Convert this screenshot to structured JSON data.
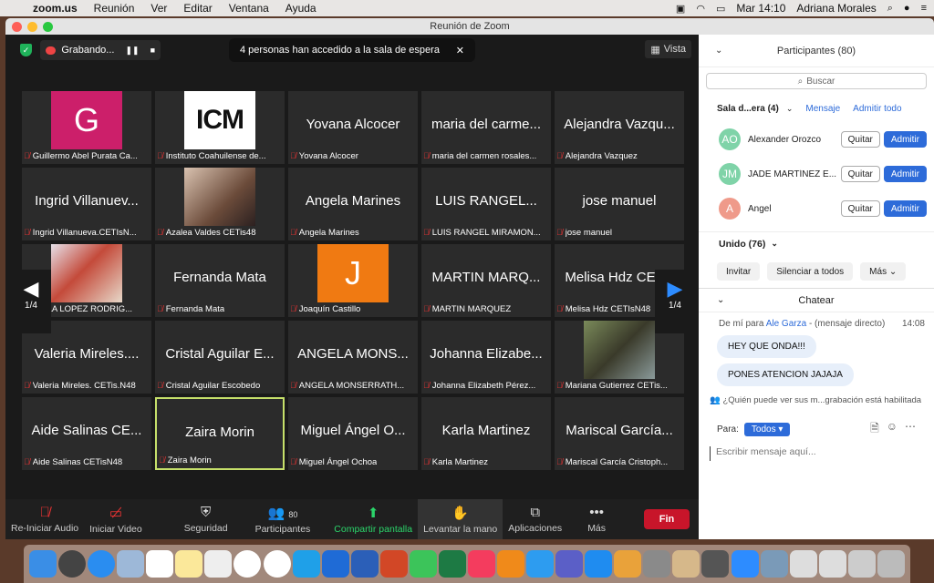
{
  "menubar": {
    "app": "zoom.us",
    "menus": [
      "Reunión",
      "Ver",
      "Editar",
      "Ventana",
      "Ayuda"
    ],
    "clock": "Mar 14:10",
    "user": "Adriana Morales"
  },
  "window": {
    "title": "Reunión de Zoom"
  },
  "topbar": {
    "recording": "Grabando...",
    "notification": "4 personas han accedido a la sala de espera",
    "view": "Vista"
  },
  "tiles": [
    {
      "big": "",
      "label": "Guillermo Abel Purata Ca...",
      "avatar": "G",
      "avatar_color": "#cc1f6a"
    },
    {
      "big": "",
      "label": "Instituto Coahuilense de...",
      "avatar": "ICM",
      "kind": "icm"
    },
    {
      "big": "Yovana Alcocer",
      "label": "Yovana Alcocer"
    },
    {
      "big": "maria del carme...",
      "label": "maria del carmen rosales..."
    },
    {
      "big": "Alejandra Vazqu...",
      "label": "Alejandra Vazquez"
    },
    {
      "big": "Ingrid Villanuev...",
      "label": "Ingrid Villanueva.CETIsN..."
    },
    {
      "big": "",
      "label": "Azalea Valdes CETis48",
      "kind": "photo1"
    },
    {
      "big": "Angela Marines",
      "label": "Angela Marines"
    },
    {
      "big": "LUIS RANGEL...",
      "label": "LUIS RANGEL MIRAMON..."
    },
    {
      "big": "jose manuel",
      "label": "jose manuel"
    },
    {
      "big": "",
      "label": "NIELA LOPEZ RODRIG...",
      "kind": "photo2"
    },
    {
      "big": "Fernanda Mata",
      "label": "Fernanda Mata"
    },
    {
      "big": "",
      "label": "Joaquín Castillo",
      "avatar": "J",
      "avatar_color": "#f07a12"
    },
    {
      "big": "MARTIN MARQ...",
      "label": "MARTIN MARQUEZ"
    },
    {
      "big": "Melisa Hdz CET...",
      "label": "Melisa Hdz CETIsN48"
    },
    {
      "big": "Valeria Mireles....",
      "label": "Valeria Mireles. CETis.N48"
    },
    {
      "big": "Cristal Aguilar E...",
      "label": "Cristal Aguilar Escobedo"
    },
    {
      "big": "ANGELA MONS...",
      "label": "ANGELA MONSERRATH..."
    },
    {
      "big": "Johanna Elizabe...",
      "label": "Johanna Elizabeth Pérez..."
    },
    {
      "big": "",
      "label": "Mariana Gutierrez CETis...",
      "kind": "photo3"
    },
    {
      "big": "Aide Salinas CE...",
      "label": "Aide Salinas CETisN48"
    },
    {
      "big": "Zaira Morin",
      "label": "Zaira Morin",
      "active": true
    },
    {
      "big": "Miguel Ángel O...",
      "label": "Miguel Ángel Ochoa"
    },
    {
      "big": "Karla Martinez",
      "label": "Karla Martinez"
    },
    {
      "big": "Mariscal García...",
      "label": "Mariscal García Cristoph..."
    }
  ],
  "pager": {
    "left": "1/4",
    "right": "1/4"
  },
  "toolbar": {
    "audio": "Re-Iniciar Audio",
    "video": "Iniciar Video",
    "security": "Seguridad",
    "participants": "Participantes",
    "participants_count": "80",
    "share": "Compartir pantalla",
    "raise": "Levantar la mano",
    "apps": "Aplicaciones",
    "more": "Más",
    "end": "Fin"
  },
  "panel": {
    "title": "Participantes (80)",
    "search": "Buscar",
    "waiting_title": "Sala d...era (4)",
    "message": "Mensaje",
    "admit_all": "Admitir todo",
    "remove": "Quitar",
    "admit": "Admitir",
    "waiting": [
      {
        "initials": "AO",
        "name": "Alexander Orozco",
        "color": "#7fd3a8"
      },
      {
        "initials": "JM",
        "name": "JADE MARTÍNEZ E...",
        "color": "#7fd3a8"
      },
      {
        "initials": "A",
        "name": "Angel",
        "color": "#ef9a8a"
      }
    ],
    "joined": "Unido (76)",
    "invite": "Invitar",
    "mute_all": "Silenciar a todos",
    "more": "Más"
  },
  "chat": {
    "title": "Chatear",
    "meta_prefix": "De mí para",
    "meta_to": "Ale Garza",
    "meta_suffix": "- (mensaje directo)",
    "time": "14:08",
    "messages": [
      "HEY QUE ONDA!!!",
      "PONES ATENCION JAJAJA"
    ],
    "notice": "¿Quién puede ver sus m...grabación está habilitada",
    "to_label": "Para:",
    "to_value": "Todos",
    "input_placeholder": "Escribir mensaje aquí..."
  }
}
